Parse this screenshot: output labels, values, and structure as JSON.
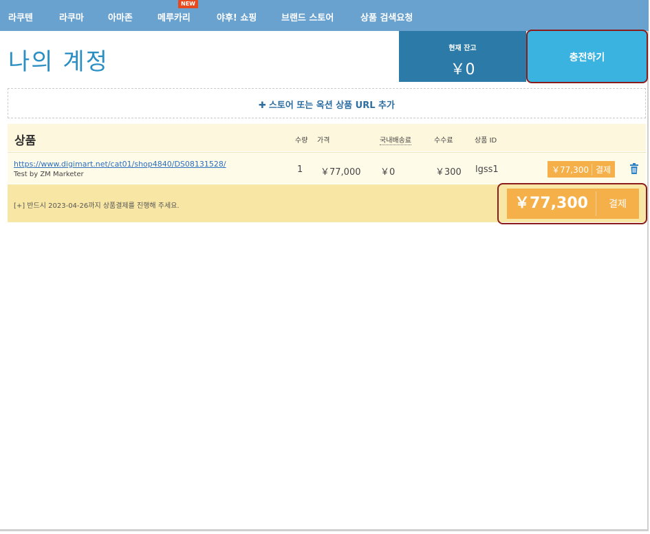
{
  "nav": {
    "items": [
      "라쿠텐",
      "라쿠마",
      "아마존",
      "메루카리",
      "야후! 쇼핑",
      "브랜드 스토어",
      "상품 검색요청"
    ],
    "new_badge": "NEW"
  },
  "header": {
    "title": "나의 계정",
    "balance_label": "현재 잔고",
    "balance_value": "￥0",
    "charge_button": "충전하기"
  },
  "add_bar": {
    "icon": "plus-icon",
    "label": "스토어 또는 옥션 상품 URL 추가"
  },
  "table": {
    "headers": {
      "product": "상품",
      "qty": "수량",
      "price": "가격",
      "shipping": "국내배송료",
      "fee": "수수료",
      "product_id": "상품 ID"
    },
    "rows": [
      {
        "url": "https://www.digimart.net/cat01/shop4840/DS08131528/",
        "note": "Test by ZM Marketer",
        "qty": "1",
        "price": "￥77,000",
        "shipping": "￥0",
        "fee": "￥300",
        "product_id": "lgss1",
        "pay_amount": "￥77,300",
        "pay_label": "결제",
        "delete_icon": "trash-icon"
      }
    ],
    "footer_note": "[+] 반드시 2023-04-26까지 상품결제를 진행해 주세요.",
    "total_amount": "￥77,300",
    "total_label": "결제"
  },
  "colors": {
    "nav_bg": "#6aa2cf",
    "title": "#2c8fc4",
    "balance_bg": "#2b7aa8",
    "charge_bg": "#3bb3e0",
    "pay_bg": "#f5b04a",
    "highlight_border": "#8b1a1a"
  }
}
